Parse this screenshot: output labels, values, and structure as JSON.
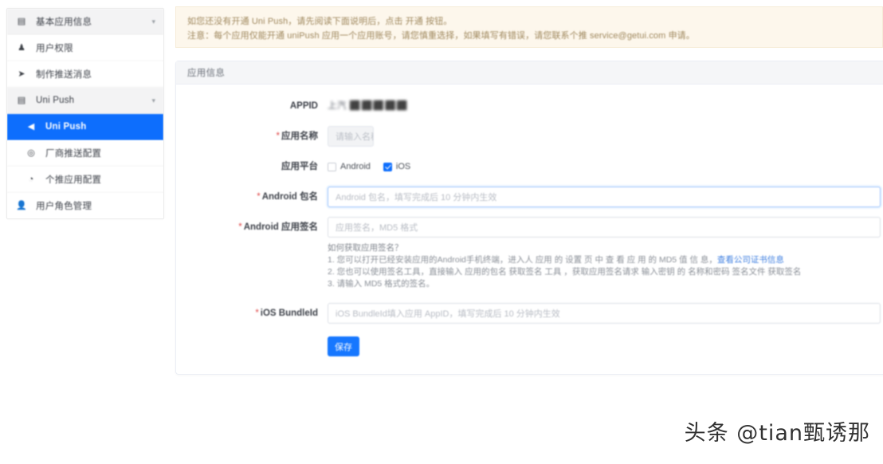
{
  "sidebar": {
    "items": [
      {
        "icon": "grid-icon",
        "label": "基本应用信息",
        "caret": "▾",
        "type": "group-collapsed"
      },
      {
        "icon": "bell-icon",
        "label": "用户权限",
        "caret": "",
        "type": "item"
      },
      {
        "icon": "send-icon",
        "label": "制作推送消息",
        "caret": "",
        "type": "item"
      },
      {
        "icon": "grid-icon",
        "label": "Uni Push",
        "caret": "▾",
        "type": "group"
      },
      {
        "icon": "megaphone-icon",
        "label": "Uni Push",
        "caret": "",
        "type": "active-sub"
      },
      {
        "icon": "circle-icon",
        "label": "厂商推送配置",
        "caret": "",
        "type": "sub"
      },
      {
        "icon": "clock-icon",
        "label": "个推应用配置",
        "caret": "",
        "type": "sub"
      },
      {
        "icon": "user-icon",
        "label": "用户角色管理",
        "caret": "",
        "type": "item"
      }
    ]
  },
  "alert": {
    "line1": "如您还没有开通 Uni Push，请先阅读下面说明后，点击 开通 按钮。",
    "line2": "注意：每个应用仅能开通 uniPush 应用一个应用账号，请您慎重选择，如果填写有错误，请您联系个推 service@getui.com 申请。"
  },
  "card": {
    "title": "应用信息",
    "fields": {
      "appid": {
        "label": "APPID",
        "value": "上汽 ⬛⬛⬛⬛⬛"
      },
      "app_name": {
        "label": "应用名称",
        "required": true,
        "placeholder": "请输入名称"
      },
      "platform": {
        "label": "应用平台",
        "required": false,
        "options": [
          {
            "label": "Android",
            "checked": false
          },
          {
            "label": "iOS",
            "checked": true
          }
        ]
      },
      "android_pkg": {
        "label": "Android 包名",
        "required": true,
        "placeholder": "Android 包名，填写完成后 10 分钟内生效",
        "focused": true
      },
      "android_sign": {
        "label": "Android 应用签名",
        "required": true,
        "placeholder": "应用签名，MD5 格式"
      },
      "ios_bundle": {
        "label": "iOS BundleId",
        "required": true,
        "placeholder": "iOS BundleId填入应用 AppID，填写完成后 10 分钟内生效"
      }
    },
    "helper": {
      "question": "如何获取应用签名？",
      "line1": "1. 您可以打开已经安装应用的Android手机终端，进入人 应用 的 设置 页 中 查 看 应 用 的 MD5 值 信 息，",
      "line1_link": "查看公司证书信息",
      "line2": "2. 您也可以使用签名工具，直接输入 应用的包名 获取签名 工具 ，获取应用签名请求 输入密钥 的 名称和密码 签名文件 获取签名",
      "line3": "3. 请输入 MD5 格式的签名。"
    },
    "submit": "保存"
  },
  "watermark": "头条 @tian甄诱那"
}
